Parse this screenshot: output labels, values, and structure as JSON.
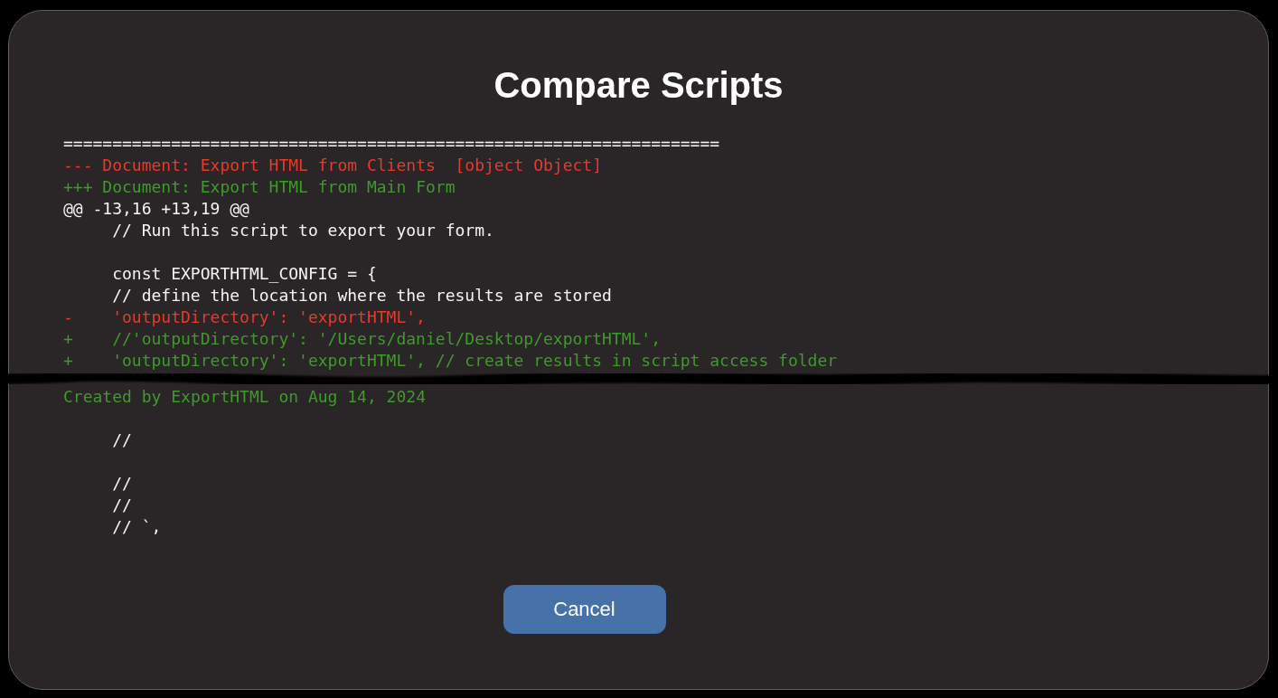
{
  "dialog": {
    "title": "Compare Scripts",
    "diff": {
      "segments": [
        {
          "lines": [
            {
              "kind": "rule",
              "text": "==================================================================="
            },
            {
              "kind": "old_file",
              "text": "--- Document: Export HTML from Clients  [object Object]"
            },
            {
              "kind": "new_file",
              "text": "+++ Document: Export HTML from Main Form"
            },
            {
              "kind": "hunk",
              "text": "@@ -13,16 +13,19 @@"
            },
            {
              "kind": "context",
              "text": "// Run this script to export your form."
            },
            {
              "kind": "blank"
            },
            {
              "kind": "context",
              "text": "const EXPORTHTML_CONFIG = {"
            },
            {
              "kind": "context",
              "text": "// define the location where the results are stored"
            },
            {
              "kind": "removed",
              "marker": "-",
              "text": "'outputDirectory': 'exportHTML',"
            },
            {
              "kind": "added",
              "marker": "+",
              "text": "//'outputDirectory': '/Users/daniel/Desktop/exportHTML',"
            },
            {
              "kind": "added",
              "marker": "+",
              "text": "'outputDirectory': 'exportHTML', // create results in script access folder"
            }
          ]
        },
        {
          "lines": [
            {
              "kind": "note",
              "text": "Created by ExportHTML on Aug 14, 2024"
            },
            {
              "kind": "blank"
            },
            {
              "kind": "context",
              "text": "//"
            },
            {
              "kind": "blank"
            },
            {
              "kind": "context",
              "text": "//"
            },
            {
              "kind": "context",
              "text": "//"
            },
            {
              "kind": "context",
              "text": "// `,"
            }
          ]
        }
      ]
    },
    "button": {
      "label": "Cancel"
    }
  }
}
